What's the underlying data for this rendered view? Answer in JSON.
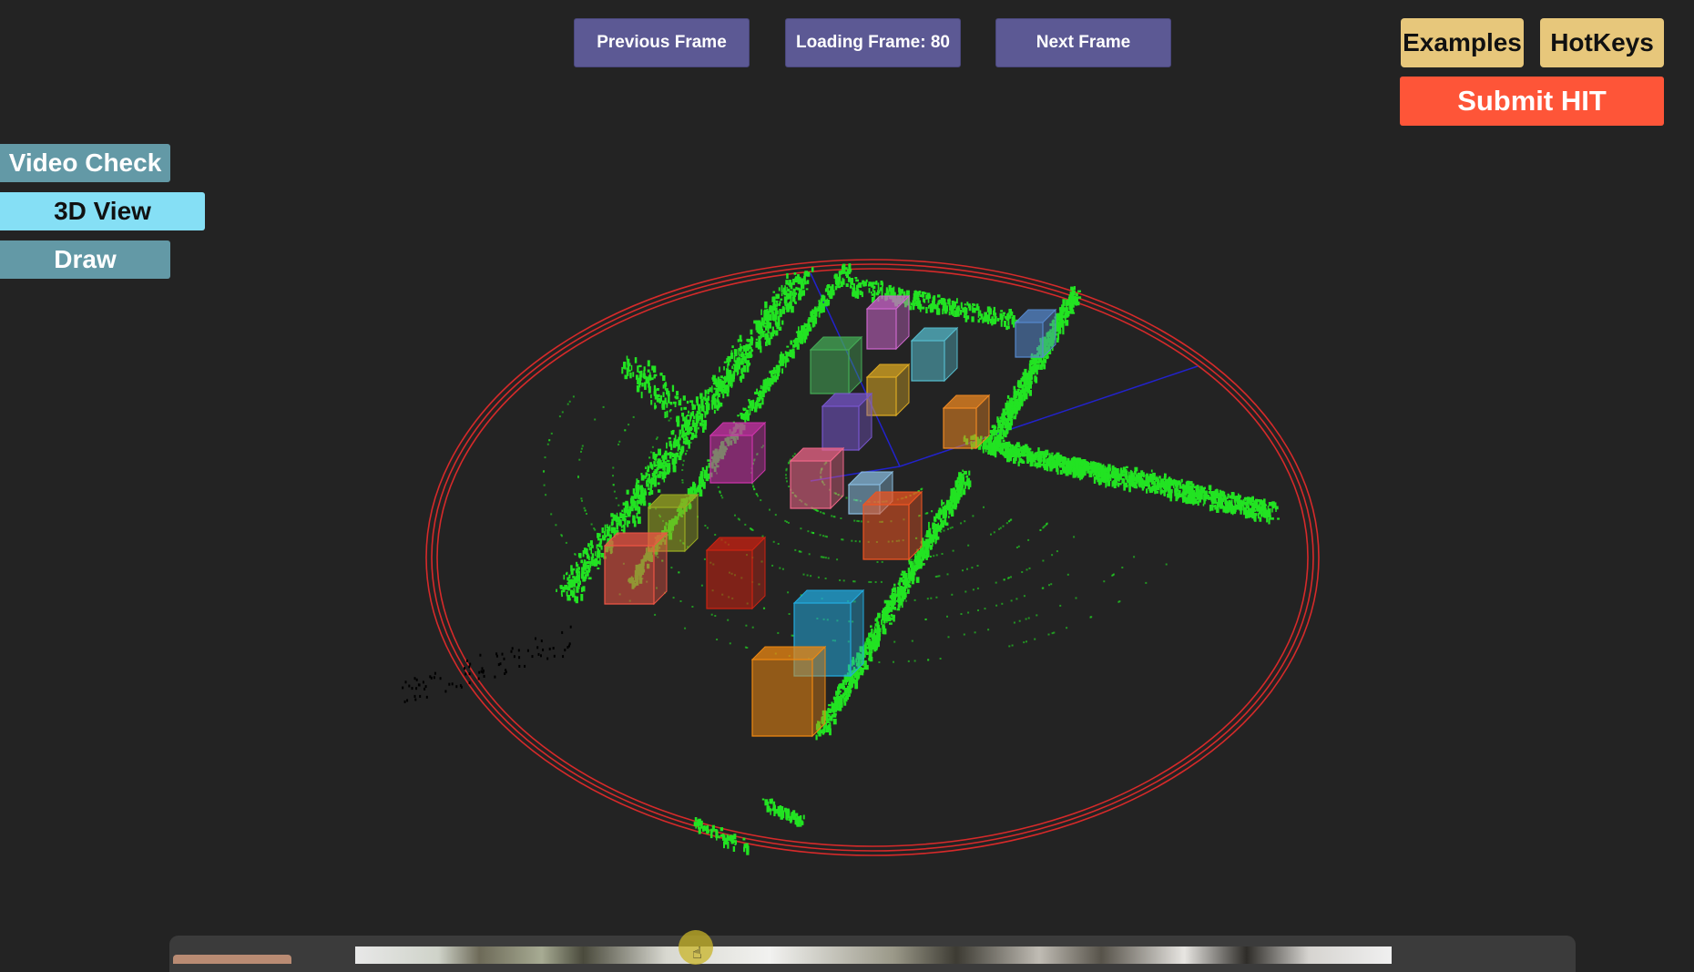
{
  "toolbar": {
    "previous_frame": "Previous Frame",
    "loading_frame": "Loading Frame: 80",
    "next_frame": "Next Frame",
    "examples": "Examples",
    "hotkeys": "HotKeys",
    "submit": "Submit HIT"
  },
  "side_menu": {
    "video_check": "Video Check",
    "view_3d": "3D View",
    "draw": "Draw",
    "active": "3D View"
  },
  "colors": {
    "nav_button": "#5c5994",
    "gold_button": "#e7c77b",
    "submit_button": "#fe5538",
    "side_inactive": "#6399a6",
    "side_active": "#85dff5",
    "point_cloud": "#22e322",
    "range_ring": "#d62a2a",
    "axis": "#2222cc",
    "background": "#232323"
  },
  "scene": {
    "type": "lidar-point-cloud-3d-view",
    "bounding_box_colors": [
      "#cc66cc",
      "#55bbcc",
      "#5588cc",
      "#44aa55",
      "#ddaa22",
      "#7755cc",
      "#ee8822",
      "#cc33aa",
      "#ee6688",
      "#88bbdd",
      "#ee5522",
      "#99aa22",
      "#ee5544",
      "#cc2211",
      "#22aadd",
      "#ee8811"
    ]
  }
}
